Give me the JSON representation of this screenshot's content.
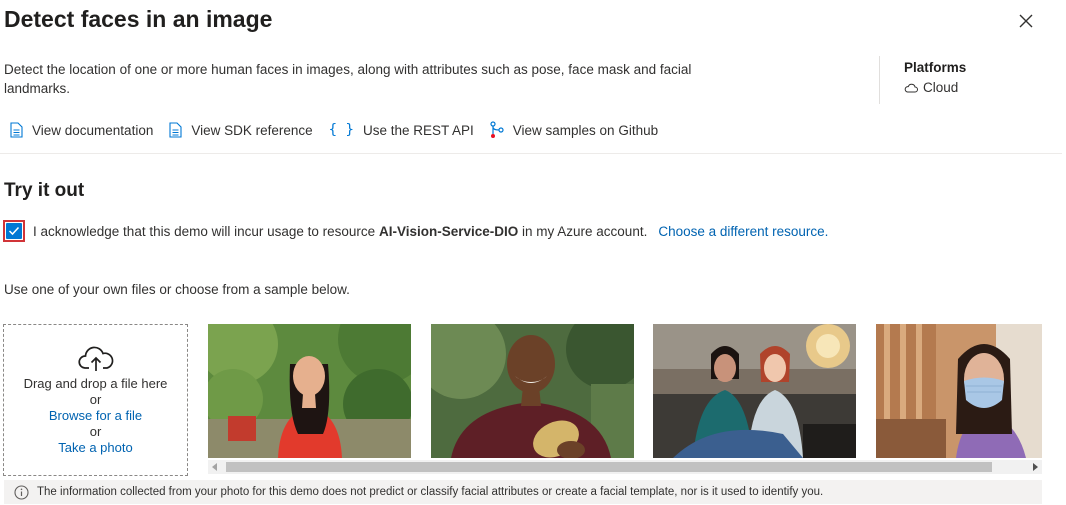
{
  "header": {
    "title": "Detect faces in an image",
    "close_icon": "close-icon"
  },
  "description": "Detect the location of one or more human faces in images, along with attributes such as pose, face mask and facial landmarks.",
  "platforms": {
    "title": "Platforms",
    "item": "Cloud",
    "icon": "cloud-icon"
  },
  "links": [
    {
      "label": "View documentation",
      "icon": "document-icon"
    },
    {
      "label": "View SDK reference",
      "icon": "document-icon"
    },
    {
      "label": "Use the REST API",
      "icon": "braces-icon"
    },
    {
      "label": "View samples on Github",
      "icon": "branch-icon"
    }
  ],
  "try_it": {
    "title": "Try it out",
    "ack_prefix": "I acknowledge that this demo will incur usage to resource",
    "resource": "AI-Vision-Service-DIO",
    "ack_suffix": "in my Azure account.",
    "change_link": "Choose a different resource.",
    "checked": true,
    "instruction": "Use one of your own files or choose from a sample below."
  },
  "dropzone": {
    "icon": "cloud-upload-icon",
    "drag_text": "Drag and drop a file here",
    "or1": "or",
    "browse": "Browse for a file",
    "or2": "or",
    "photo": "Take a photo"
  },
  "samples": [
    {
      "name": "woman-red-dress-garden"
    },
    {
      "name": "man-maroon-shirt-mask"
    },
    {
      "name": "two-women-fabric-store"
    },
    {
      "name": "woman-face-mask"
    }
  ],
  "info": {
    "icon": "info-icon",
    "text": "The information collected from your photo for this demo does not predict or classify facial attributes or create a facial template, nor is it used to identify you."
  },
  "colors": {
    "accent": "#0078d4",
    "link": "#0063b1",
    "highlight_border": "#d13438"
  }
}
